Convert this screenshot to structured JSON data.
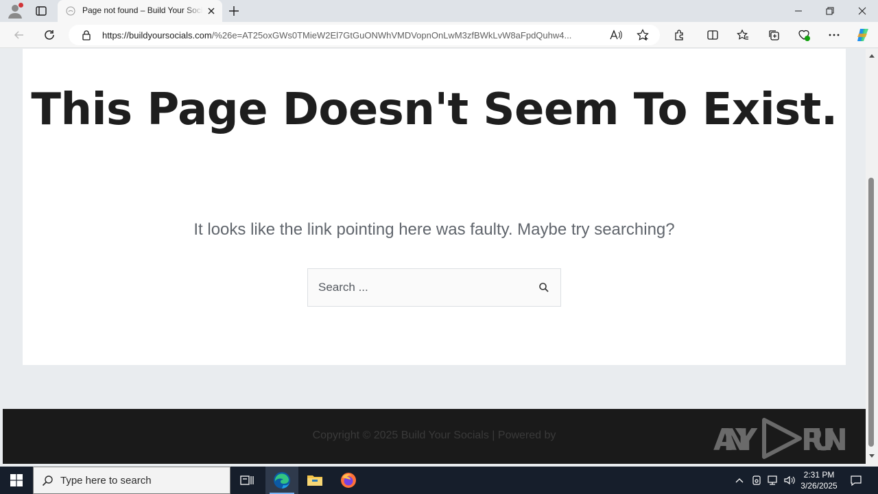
{
  "browser": {
    "tab_title": "Page not found – Build Your Socials",
    "url_host": "https://buildyoursocials.com",
    "url_path": "/%26e=AT25oxGWs0TMieW2El7GtGuONWhVMDVopnOnLwM3zfBWkLvW8aFpdQuhw4..."
  },
  "page": {
    "headline": "This Page Doesn't Seem To Exist.",
    "subtext": "It looks like the link pointing here was faulty. Maybe try searching?",
    "search_placeholder": "Search ...",
    "copyright": "Copyright © 2025 Build Your Socials | Powered by",
    "watermark": "ANY RUN"
  },
  "taskbar": {
    "search_placeholder": "Type here to search",
    "time": "2:31 PM",
    "date": "3/26/2025"
  },
  "colors": {
    "accent_blue": "#0078d4",
    "footer_bg": "#1a1a1a",
    "taskbar_bg": "#161e2b"
  }
}
